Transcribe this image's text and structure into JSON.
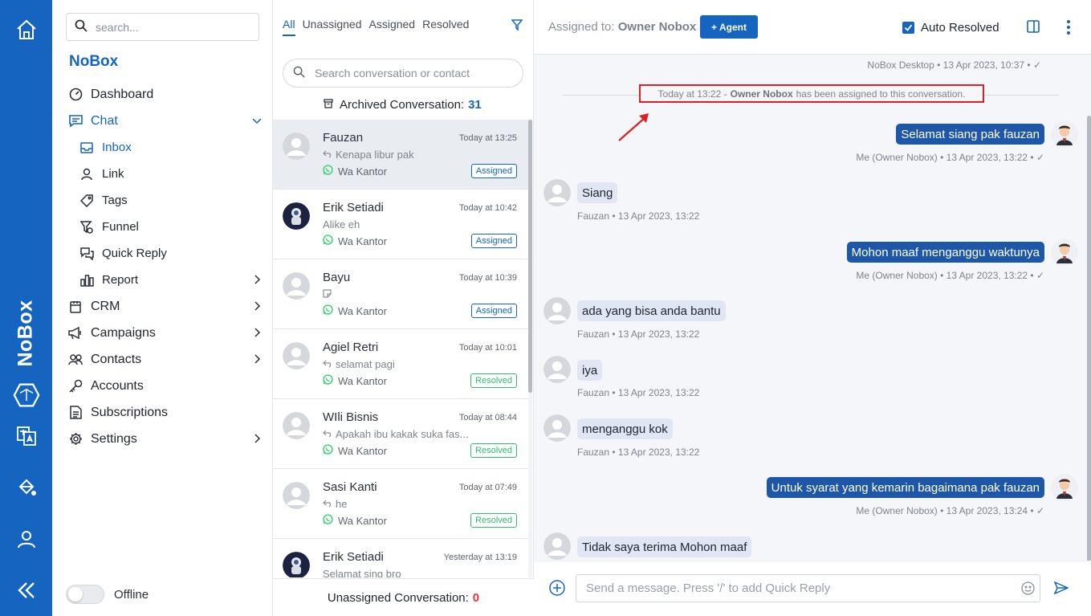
{
  "rail": {
    "brand": "NoBox"
  },
  "sidebar": {
    "search_placeholder": "search...",
    "brand": "NoBox",
    "nav": [
      {
        "label": "Dashboard",
        "icon": "dashboard-icon"
      },
      {
        "label": "Chat",
        "icon": "chat-icon"
      },
      {
        "label": "Inbox",
        "icon": "inbox-icon"
      },
      {
        "label": "Link",
        "icon": "user-icon"
      },
      {
        "label": "Tags",
        "icon": "tag-icon"
      },
      {
        "label": "Funnel",
        "icon": "funnel-icon"
      },
      {
        "label": "Quick Reply",
        "icon": "quick-reply-icon"
      },
      {
        "label": "Report",
        "icon": "report-icon"
      },
      {
        "label": "CRM",
        "icon": "crm-icon"
      },
      {
        "label": "Campaigns",
        "icon": "megaphone-icon"
      },
      {
        "label": "Contacts",
        "icon": "contacts-icon"
      },
      {
        "label": "Accounts",
        "icon": "key-icon"
      },
      {
        "label": "Subscriptions",
        "icon": "document-icon"
      },
      {
        "label": "Settings",
        "icon": "gear-icon"
      }
    ],
    "status_label": "Offline"
  },
  "convlist": {
    "tabs": [
      "All",
      "Unassigned",
      "Assigned",
      "Resolved"
    ],
    "search_placeholder": "Search conversation or contact",
    "archived_label": "Archived Conversation:",
    "archived_count": "31",
    "unassigned_label": "Unassigned Conversation:",
    "unassigned_count": "0",
    "items": [
      {
        "name": "Fauzan",
        "time": "Today at 13:25",
        "preview": "Kenapa libur pak",
        "channel": "Wa Kantor",
        "status": "Assigned"
      },
      {
        "name": "Erik Setiadi",
        "time": "Today at 10:42",
        "preview": "Alike eh",
        "channel": "Wa Kantor",
        "status": "Assigned"
      },
      {
        "name": "Bayu",
        "time": "Today at 10:39",
        "preview": "",
        "channel": "Wa Kantor",
        "status": "Assigned"
      },
      {
        "name": "Agiel Retri",
        "time": "Today at 10:01",
        "preview": "selamat pagi",
        "channel": "Wa Kantor",
        "status": "Resolved"
      },
      {
        "name": "WIli Bisnis",
        "time": "Today at 08:44",
        "preview": "Apakah ibu kakak suka fas...",
        "channel": "Wa Kantor",
        "status": "Resolved"
      },
      {
        "name": "Sasi Kanti",
        "time": "Today at 07:49",
        "preview": "he",
        "channel": "Wa Kantor",
        "status": "Resolved"
      },
      {
        "name": "Erik Setiadi",
        "time": "Yesterday at 13:19",
        "preview": "Selamat sing bro",
        "channel": "",
        "status": ""
      }
    ]
  },
  "chat": {
    "assigned_to_label": "Assigned to:",
    "assigned_to_name": "Owner Nobox",
    "agent_button": "+ Agent",
    "auto_resolved_label": "Auto Resolved",
    "top_meta": "NoBox Desktop • 13 Apr 2023, 10:37 • ✓",
    "system": {
      "prefix": "Today at 13:22 -",
      "name": "Owner Nobox",
      "suffix": "has been assigned to this conversation."
    },
    "messages": [
      {
        "dir": "out",
        "text": "Selamat siang pak fauzan",
        "meta": "Me (Owner Nobox) • 13 Apr 2023, 13:22 • ✓"
      },
      {
        "dir": "in",
        "text": "Siang",
        "meta": "Fauzan • 13 Apr 2023, 13:22"
      },
      {
        "dir": "out",
        "text": "Mohon maaf menganggu waktunya",
        "meta": "Me (Owner Nobox) • 13 Apr 2023, 13:22 • ✓"
      },
      {
        "dir": "in",
        "text": "ada yang bisa anda bantu",
        "meta": "Fauzan • 13 Apr 2023, 13:22"
      },
      {
        "dir": "in",
        "text": "iya",
        "meta": "Fauzan • 13 Apr 2023, 13:22"
      },
      {
        "dir": "in",
        "text": "menganggu kok",
        "meta": "Fauzan • 13 Apr 2023, 13:22"
      },
      {
        "dir": "out",
        "text": "Untuk syarat yang kemarin bagaimana pak fauzan",
        "meta": "Me (Owner Nobox) • 13 Apr 2023, 13:24 • ✓"
      },
      {
        "dir": "in",
        "text": "Tidak saya terima Mohon maaf",
        "meta": ""
      }
    ],
    "composer_placeholder": "Send a message. Press '/' to add Quick Reply"
  },
  "colors": {
    "brand": "#1565c0",
    "assigned": "#1565c0",
    "resolved": "#2ebd6b",
    "highlight": "#e02020",
    "count_red": "#e53935"
  }
}
